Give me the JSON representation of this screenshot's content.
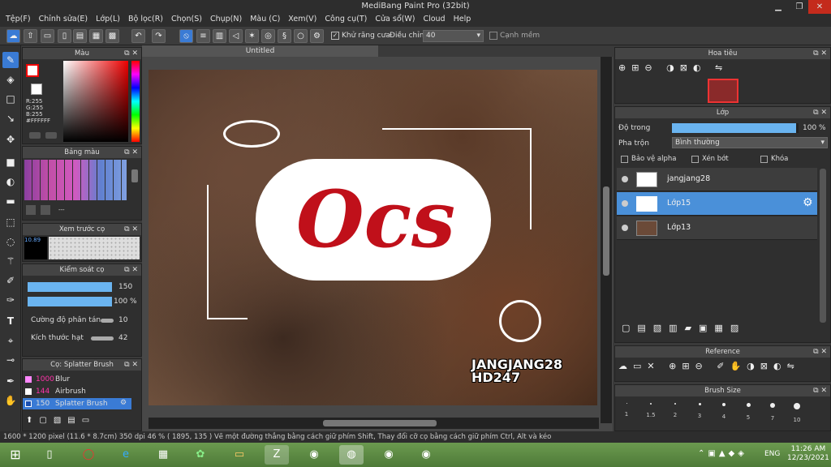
{
  "title": "MediBang Paint Pro (32bit)",
  "menu": [
    "Tệp(F)",
    "Chỉnh sửa(E)",
    "Lớp(L)",
    "Bộ lọc(R)",
    "Chọn(S)",
    "Chụp(N)",
    "Màu (C)",
    "Xem(V)",
    "Công cụ(T)",
    "Cửa sổ(W)",
    "Cloud",
    "Help"
  ],
  "toolbar": {
    "antialias": "Khử răng cưa",
    "adjust_label": "Điều chỉnh",
    "adjust_value": "40",
    "edge": "Cạnh mềm"
  },
  "color_panel": {
    "title": "Màu",
    "r": "R:255",
    "g": "G:255",
    "b": "B:255",
    "hex": "#FFFFFF"
  },
  "palette_panel": {
    "title": "Bảng màu",
    "extra": "---"
  },
  "brush_preview": {
    "title": "Xem trước cọ",
    "size": "10.89"
  },
  "brush_control": {
    "title": "Kiểm soát cọ",
    "size": "150",
    "opacity": "100 %",
    "scatter_label": "Cường độ phân tán",
    "scatter_value": "10",
    "particle_label": "Kích thước hạt",
    "particle_value": "42"
  },
  "brush_list": {
    "title": "Cọ: Splatter Brush",
    "items": [
      {
        "size": "1000",
        "name": "Blur",
        "color": "#ff88ff"
      },
      {
        "size": "144",
        "name": "Airbrush",
        "color": "#ffffff"
      },
      {
        "size": "150",
        "name": "Splatter Brush",
        "color": "#3a7bd5"
      }
    ]
  },
  "canvas": {
    "tab": "Untitled",
    "big_text": "Ocs",
    "caption1": "JANGJANG28",
    "caption2": "HD247"
  },
  "navigator": {
    "title": "Hoa tiêu"
  },
  "layer_panel": {
    "title": "Lớp",
    "opacity_label": "Độ trong",
    "opacity_value": "100 %",
    "opacity_level": 0.98,
    "blend_label": "Pha trộn",
    "blend_value": "Bình thường",
    "protect_alpha": "Bảo vệ alpha",
    "clipping": "Xén bớt",
    "lock": "Khóa",
    "layers": [
      "jangjang28",
      "Lớp15",
      "Lớp13"
    ]
  },
  "reference": {
    "title": "Reference"
  },
  "brush_size": {
    "title": "Brush Size",
    "sizes": [
      "1",
      "1.5",
      "2",
      "3",
      "4",
      "5",
      "7",
      "10"
    ]
  },
  "status": {
    "dims": "1600 * 1200 pixel",
    "cm": "(11.6 * 8.7cm)",
    "dpi": "350 dpi",
    "zoom": "46 %",
    "coord": "( 1895, 135 )",
    "hint": "Vẽ một đường thẳng bằng cách giữ phím Shift, Thay đổi cỡ cọ bằng cách giữ phím Ctrl, Alt và kéo"
  },
  "taskbar": {
    "lang": "ENG",
    "time": "11:26 AM",
    "date": "12/23/2021"
  },
  "colors": {
    "accent": "#3a7bd5",
    "panel": "#2f2f2f",
    "taskbar": "#5b8a43"
  }
}
